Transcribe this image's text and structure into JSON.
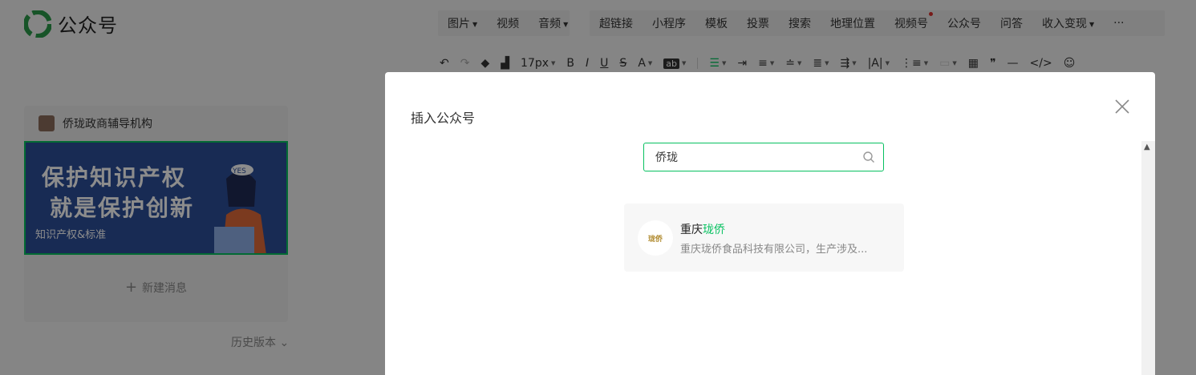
{
  "header": {
    "logo_text": "公众号",
    "insert_group_1": [
      {
        "label": "图片",
        "has_caret": true
      },
      {
        "label": "视频",
        "has_caret": false
      },
      {
        "label": "音频",
        "has_caret": true
      }
    ],
    "insert_group_2": [
      {
        "label": "超链接",
        "has_caret": false
      },
      {
        "label": "小程序",
        "has_caret": false
      },
      {
        "label": "模板",
        "has_caret": false
      },
      {
        "label": "投票",
        "has_caret": false
      },
      {
        "label": "搜索",
        "has_caret": false
      },
      {
        "label": "地理位置",
        "has_caret": false
      },
      {
        "label": "视频号",
        "has_caret": false,
        "badge": true
      },
      {
        "label": "公众号",
        "has_caret": false
      },
      {
        "label": "问答",
        "has_caret": false
      },
      {
        "label": "收入变现",
        "has_caret": true
      },
      {
        "label": "···",
        "has_caret": false
      }
    ]
  },
  "toolbar": {
    "font_size": "17px",
    "bold": "B",
    "italic": "I",
    "underline": "U",
    "strike": "S",
    "font_color": "A",
    "highlight": "ab",
    "quote": "❞",
    "divider": "—",
    "code": "</>"
  },
  "article": {
    "account_name": "侨珑政商辅导机构",
    "cover_line1": "保护知识产权",
    "cover_line2": "就是保护创新",
    "cover_tag": "知识产权&标准",
    "cover_badge": "YES",
    "new_message": "新建消息",
    "history": "历史版本"
  },
  "dialog": {
    "title": "插入公众号",
    "search_value": "侨珑",
    "result": {
      "name_prefix": "重庆",
      "name_highlight": "珑侨",
      "description": "重庆珑侨食品科技有限公司，生产涉及...",
      "avatar_text": "珑侨"
    }
  },
  "colors": {
    "brand_green": "#07c160",
    "overlay": "rgba(0,0,0,0.45)",
    "badge_red": "#d9302c"
  }
}
